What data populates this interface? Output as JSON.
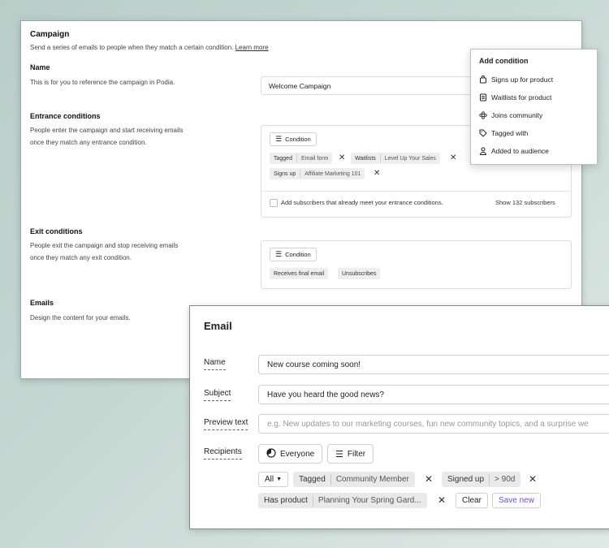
{
  "campaign": {
    "title": "Campaign",
    "description": "Send a series of emails to people when they match a certain condition.",
    "learn_more": "Learn more",
    "name_section": {
      "title": "Name",
      "description": "This is for you to reference the campaign in Podia.",
      "value": "Welcome Campaign"
    },
    "entrance": {
      "title": "Entrance conditions",
      "description_line1": "People enter the campaign and start receiving emails",
      "description_line2": "once they match any entrance condition.",
      "condition_button": "Condition",
      "tags": [
        {
          "type": "Tagged",
          "value": "Email form"
        },
        {
          "type": "Waitlists",
          "value": "Level Up Your Sales"
        },
        {
          "type": "Signs up",
          "value": "Affiliate Marketing 101"
        }
      ],
      "checkbox_label": "Add subscribers that already meet your entrance conditions.",
      "show_link": "Show 132 subscribers"
    },
    "exit": {
      "title": "Exit conditions",
      "description_line1": "People exit the campaign and stop receiving emails",
      "description_line2": "once they match any exit condition.",
      "condition_button": "Condition",
      "tags": [
        "Receives final email",
        "Unsubscribes"
      ]
    },
    "emails": {
      "title": "Emails",
      "description": "Design the content for your emails."
    }
  },
  "dropdown": {
    "title": "Add condition",
    "items": [
      {
        "label": "Signs up for product",
        "icon": "bag-icon"
      },
      {
        "label": "Waitlists for product",
        "icon": "list-icon"
      },
      {
        "label": "Joins community",
        "icon": "community-icon"
      },
      {
        "label": "Tagged with",
        "icon": "tag-icon"
      },
      {
        "label": "Added to audience",
        "icon": "person-icon"
      }
    ]
  },
  "email": {
    "title": "Email",
    "name_label": "Name",
    "name_value": "New course coming soon!",
    "subject_label": "Subject",
    "subject_value": "Have you heard the good news?",
    "preview_label": "Preview text",
    "preview_placeholder": "e.g. New updates to our marketing courses, fun new community topics, and a surprise we",
    "recipients_label": "Recipients",
    "everyone_button": "Everyone",
    "filter_button": "Filter",
    "all_select": "All",
    "filters": [
      {
        "type": "Tagged",
        "value": "Community Member"
      },
      {
        "type": "Signed up",
        "value": "> 90d"
      },
      {
        "type": "Has product",
        "value": "Planning Your Spring Gard..."
      }
    ],
    "clear_button": "Clear",
    "save_new_button": "Save new",
    "accent_color": "#6b4fd1"
  }
}
